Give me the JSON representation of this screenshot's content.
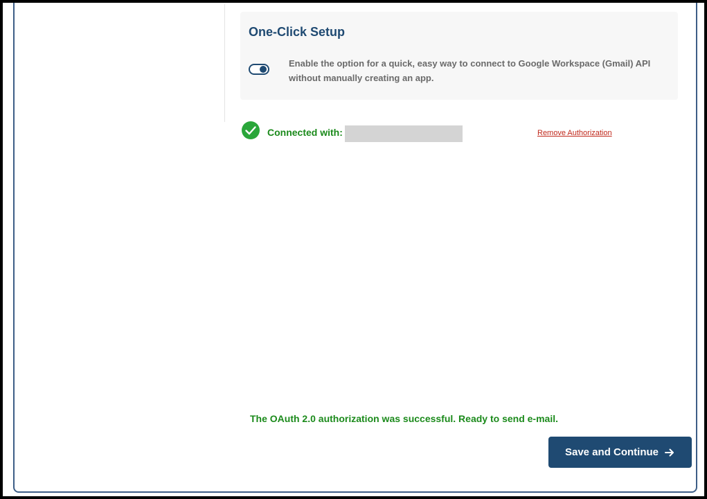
{
  "setup": {
    "title": "One-Click Setup",
    "description": "Enable the option for a quick, easy way to connect to Google Workspace (Gmail) API without manually creating an app.",
    "toggle_on": true
  },
  "connection": {
    "label": "Connected with:",
    "remove_label": "Remove Authorization",
    "icon": "check-circle-icon"
  },
  "status": {
    "message": "The OAuth 2.0 authorization was successful. Ready to send e-mail."
  },
  "actions": {
    "save_label": "Save and Continue",
    "save_icon": "arrow-right-icon"
  },
  "colors": {
    "primary": "#1f4a72",
    "success": "#1b8a1b",
    "danger": "#c0281b",
    "panel_bg": "#f7f7f7"
  }
}
